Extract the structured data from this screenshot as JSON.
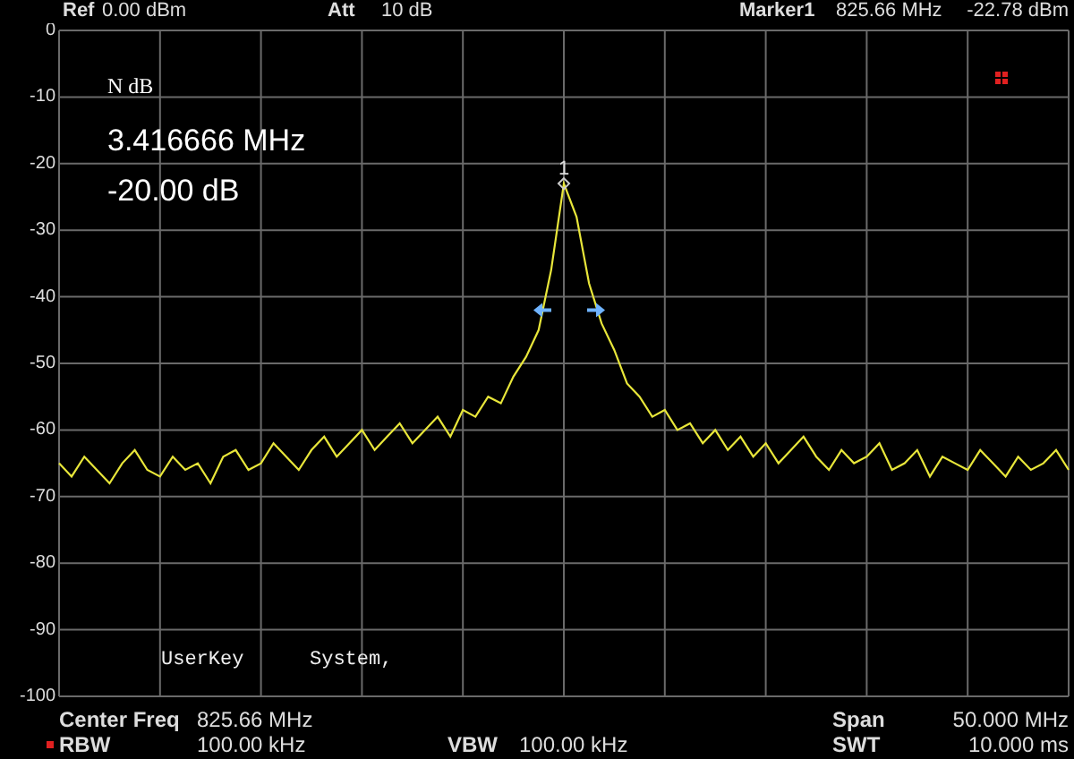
{
  "header": {
    "ref_label": "Ref",
    "ref_value": "0.00 dBm",
    "att_label": "Att",
    "att_value": "10 dB",
    "marker_label": "Marker1",
    "marker_freq": "825.66 MHz",
    "marker_level": "-22.78 dBm"
  },
  "plot": {
    "chart_data": {
      "type": "line",
      "grid": true,
      "ylim": [
        -100,
        0
      ],
      "yticks": [
        0,
        -10,
        -20,
        -30,
        -40,
        -50,
        -60,
        -70,
        -80,
        -90,
        -100
      ],
      "series": [
        {
          "color": "#e8e63a",
          "values": [
            -65,
            -67,
            -64,
            -66,
            -68,
            -65,
            -63,
            -66,
            -67,
            -64,
            -66,
            -65,
            -68,
            -64,
            -63,
            -66,
            -65,
            -62,
            -64,
            -66,
            -63,
            -61,
            -64,
            -62,
            -60,
            -63,
            -61,
            -59,
            -62,
            -60,
            -58,
            -61,
            -57,
            -58,
            -55,
            -56,
            -52,
            -49,
            -45,
            -36,
            -23,
            -28,
            -38,
            -44,
            -48,
            -53,
            -55,
            -58,
            -57,
            -60,
            -59,
            -62,
            -60,
            -63,
            -61,
            -64,
            -62,
            -65,
            -63,
            -61,
            -64,
            -66,
            -63,
            -65,
            -64,
            -62,
            -66,
            -65,
            -63,
            -67,
            -64,
            -65,
            -66,
            -63,
            -65,
            -67,
            -64,
            -66,
            -65,
            -63,
            -66
          ]
        }
      ]
    },
    "ndb": {
      "title": "N dB",
      "bandwidth": "3.416666 MHz",
      "level": "-20.00 dB"
    },
    "marker": {
      "label": "1"
    },
    "softkeys": [
      "UserKey",
      "System,"
    ]
  },
  "footer": [
    [
      {
        "label": "Center Freq",
        "value": "825.66 MHz",
        "flagged": false
      },
      {
        "label": "Span",
        "value": "50.000 MHz",
        "flagged": false
      }
    ],
    [
      {
        "label": "RBW",
        "value": "100.00 kHz",
        "flagged": true
      },
      {
        "label": "VBW",
        "value": "100.00 kHz",
        "flagged": false
      },
      {
        "label": "SWT",
        "value": "10.000 ms",
        "flagged": false
      }
    ]
  ]
}
